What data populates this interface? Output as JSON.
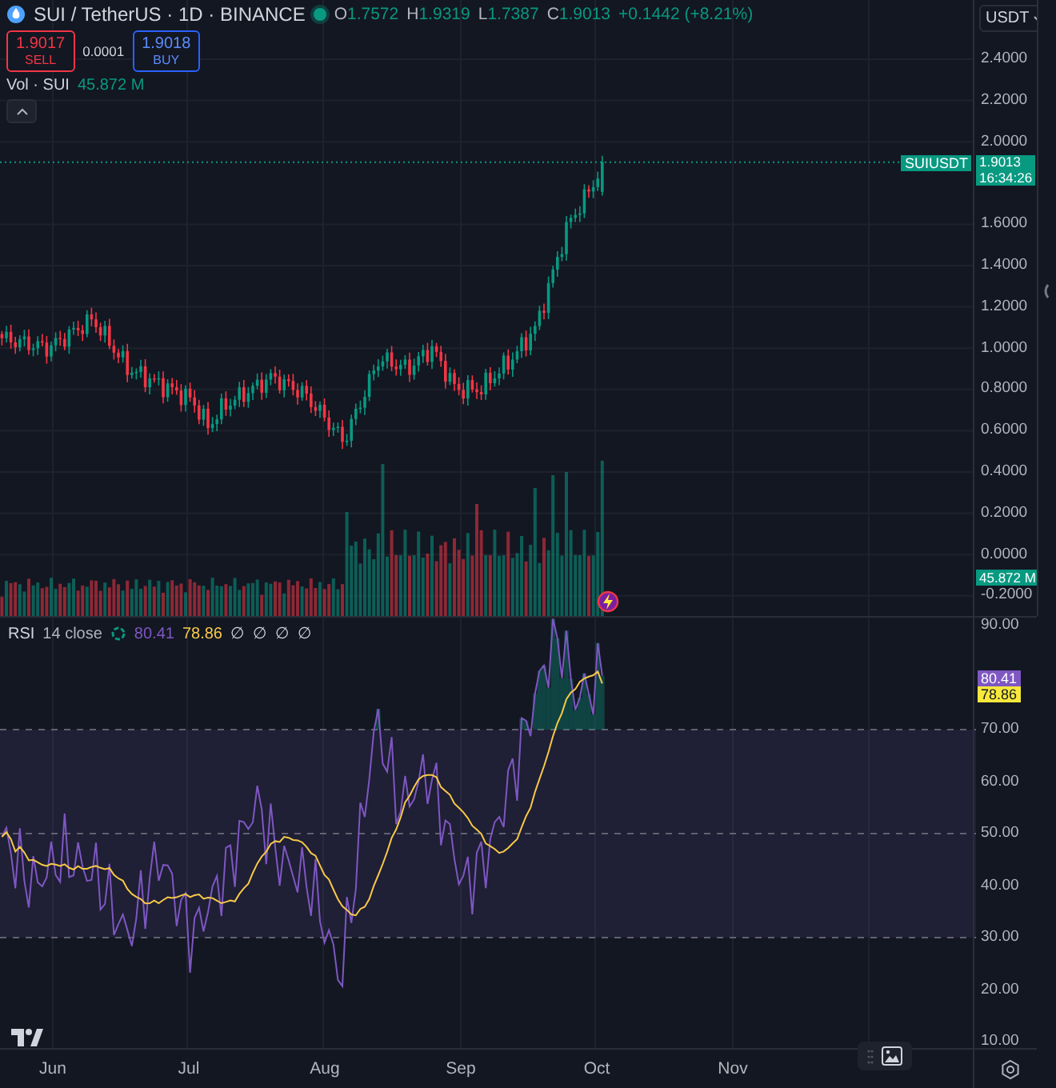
{
  "symbol": {
    "title": "SUI / TetherUS · 1D · BINANCE",
    "market_open": true,
    "ohlc": [
      {
        "label": "O",
        "value": "1.7572"
      },
      {
        "label": "H",
        "value": "1.9319"
      },
      {
        "label": "L",
        "value": "1.7387"
      },
      {
        "label": "C",
        "value": "1.9013"
      }
    ],
    "change": "+0.1442 (+8.21%)"
  },
  "trade": {
    "sell": {
      "price": "1.9017",
      "label": "SELL"
    },
    "spread": "0.0001",
    "buy": {
      "price": "1.9018",
      "label": "BUY"
    }
  },
  "volume_legend": {
    "name": "Vol · SUI",
    "value": "45.872 M"
  },
  "currency": "USDT",
  "price_axis": {
    "ticks": [
      "2.4000",
      "2.2000",
      "2.0000",
      "1.6000",
      "1.4000",
      "1.2000",
      "1.0000",
      "0.8000",
      "0.6000",
      "0.4000",
      "0.2000",
      "0.0000",
      "-0.2000"
    ],
    "symbol_label": "SUIUSDT",
    "last_price": "1.9013",
    "countdown": "16:34:26",
    "volume_badge": "45.872 M"
  },
  "rsi": {
    "name": "RSI",
    "params": "14 close",
    "value": "80.41",
    "ma_value": "78.86",
    "value_badge": "80.41",
    "ma_badge": "78.86",
    "extras": [
      "∅",
      "∅",
      "∅",
      "∅"
    ],
    "axis_ticks": [
      "90.00",
      "70.00",
      "60.00",
      "50.00",
      "40.00",
      "30.00",
      "20.00",
      "10.00"
    ]
  },
  "time_axis": {
    "labels": [
      "Jun",
      "Jul",
      "Aug",
      "Sep",
      "Oct",
      "Nov"
    ]
  }
}
